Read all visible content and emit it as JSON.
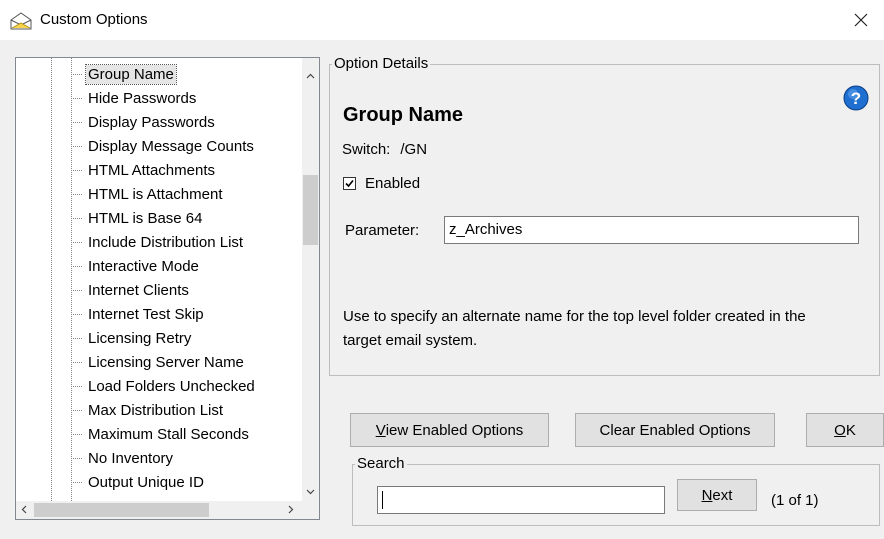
{
  "window": {
    "title": "Custom Options",
    "close_glyph": "×"
  },
  "tree": {
    "items": [
      {
        "label": "Group Name",
        "selected": true
      },
      {
        "label": "Hide Passwords"
      },
      {
        "label": "Display Passwords"
      },
      {
        "label": "Display Message Counts"
      },
      {
        "label": "HTML Attachments"
      },
      {
        "label": "HTML is Attachment"
      },
      {
        "label": "HTML is Base 64"
      },
      {
        "label": "Include Distribution List"
      },
      {
        "label": "Interactive Mode"
      },
      {
        "label": "Internet Clients"
      },
      {
        "label": "Internet Test Skip"
      },
      {
        "label": "Licensing Retry"
      },
      {
        "label": "Licensing Server Name"
      },
      {
        "label": "Load Folders Unchecked"
      },
      {
        "label": "Max Distribution List"
      },
      {
        "label": "Maximum Stall Seconds"
      },
      {
        "label": "No Inventory"
      },
      {
        "label": "Output Unique ID"
      }
    ]
  },
  "details": {
    "legend": "Option Details",
    "title": "Group Name",
    "switch_label": "Switch:",
    "switch_value": "/GN",
    "enabled_label": "Enabled",
    "enabled": true,
    "parameter_label": "Parameter:",
    "parameter_value": "z_Archives",
    "description": "Use to specify an alternate name for the top level folder created in the target email system."
  },
  "buttons": {
    "view_enabled_mnemonic": "V",
    "view_enabled_rest": "iew Enabled Options",
    "clear_enabled": "Clear Enabled Options",
    "ok_mnemonic": "O",
    "ok_rest": "K"
  },
  "search": {
    "legend": "Search",
    "value": "",
    "next_mnemonic": "N",
    "next_rest": "ext",
    "count": "(1 of 1)"
  },
  "colors": {
    "help_icon": "#1e6fd0",
    "accent_selection": "#e5e5e5"
  }
}
